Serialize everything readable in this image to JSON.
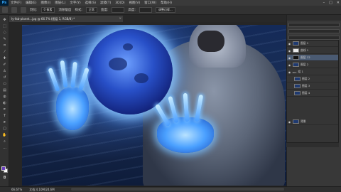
{
  "app": {
    "logo": "Ps"
  },
  "menu": [
    "文件(F)",
    "编辑(E)",
    "图像(I)",
    "图层(L)",
    "文字(Y)",
    "选择(S)",
    "滤镜(T)",
    "3D(D)",
    "视图(V)",
    "窗口(W)",
    "帮助(H)"
  ],
  "options": {
    "feather_label": "羽化:",
    "feather_value": "0 像素",
    "antialias_label": "消除锯齿",
    "style_label": "样式:",
    "style_value": "正常",
    "width_label": "宽度:",
    "height_label": "高度:",
    "refine_label": "调整边缘..."
  },
  "document": {
    "tab": "ly-fab-planet...jpg @ 66.7% (图层 1, RGB/8) *"
  },
  "layers": [
    {
      "name": "图层 1",
      "selected": false
    },
    {
      "name": "曲线 1",
      "selected": false
    },
    {
      "name": "图层 12",
      "selected": true
    },
    {
      "name": "图层 2",
      "selected": false
    },
    {
      "name": "组 1",
      "selected": false
    },
    {
      "name": "图层 2",
      "selected": false
    },
    {
      "name": "图层 3",
      "selected": false
    },
    {
      "name": "图层 4",
      "selected": false
    },
    {
      "name": "背景",
      "selected": false
    }
  ],
  "status": {
    "zoom": "66.67%",
    "doc": "文档:4.10M/24.6M"
  },
  "colors": {
    "foreground": "#6a3fbf",
    "background": "#ffffff",
    "selected_layer": "#4a5a72"
  }
}
